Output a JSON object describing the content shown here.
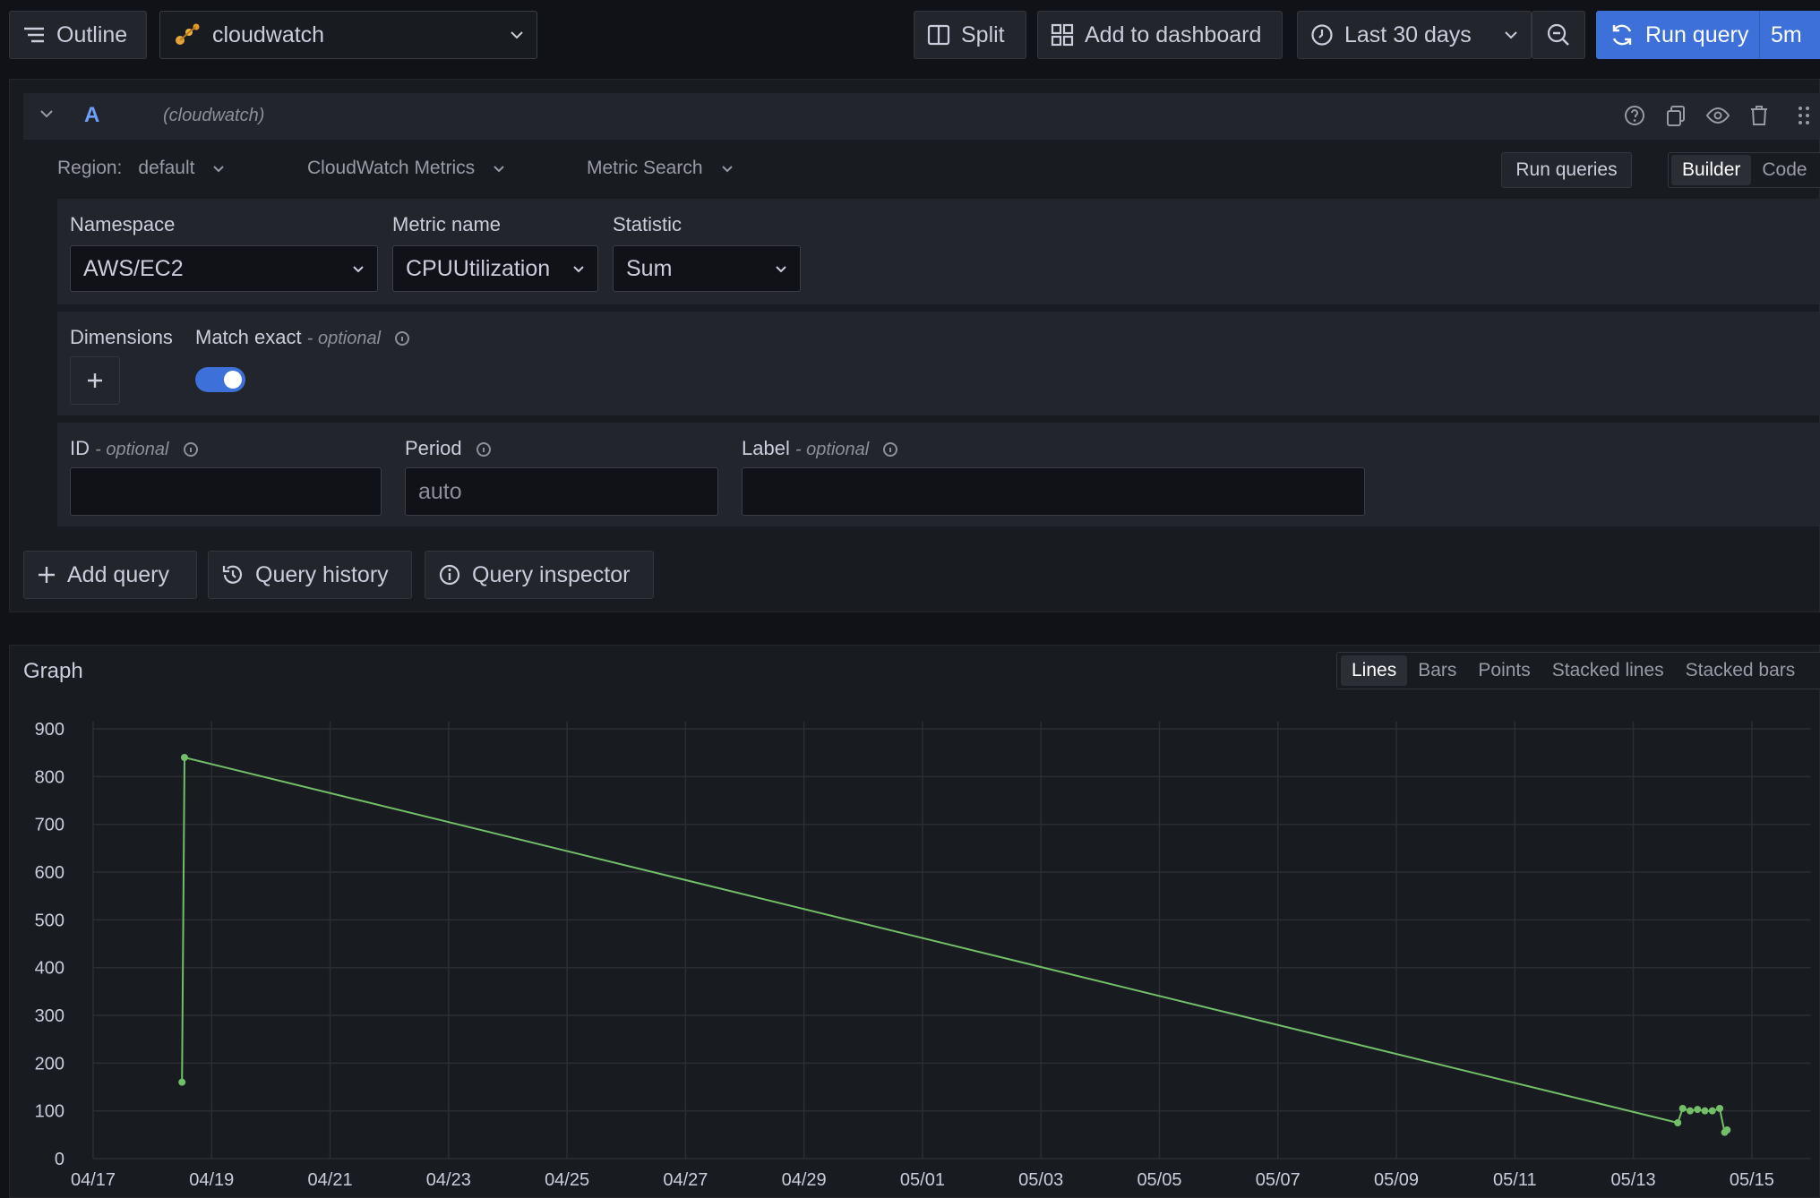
{
  "toolbar": {
    "outline_label": "Outline",
    "datasource": "cloudwatch",
    "split_label": "Split",
    "add_to_dashboard_label": "Add to dashboard",
    "time_range": "Last 30 days",
    "run_query_label": "Run query",
    "refresh_interval": "5m"
  },
  "query": {
    "ref_id": "A",
    "datasource_tag": "(cloudwatch)",
    "region_label": "Region:",
    "region_value": "default",
    "service": "CloudWatch Metrics",
    "mode": "Metric Search",
    "run_queries_label": "Run queries",
    "builder_label": "Builder",
    "code_label": "Code",
    "namespace_label": "Namespace",
    "namespace_value": "AWS/EC2",
    "metric_name_label": "Metric name",
    "metric_name_value": "CPUUtilization",
    "statistic_label": "Statistic",
    "statistic_value": "Sum",
    "dimensions_label": "Dimensions",
    "match_exact_label": "Match exact",
    "optional_text": "- optional",
    "id_label": "ID",
    "period_label": "Period",
    "period_placeholder": "auto",
    "label_label": "Label",
    "match_exact_enabled": true
  },
  "actions": {
    "add_query_label": "Add query",
    "query_history_label": "Query history",
    "query_inspector_label": "Query inspector"
  },
  "graph": {
    "title": "Graph",
    "modes": [
      "Lines",
      "Bars",
      "Points",
      "Stacked lines",
      "Stacked bars"
    ],
    "active_mode": "Lines"
  },
  "colors": {
    "accent": "#3d71d9",
    "series": "#73bf69"
  },
  "chart_data": {
    "type": "line",
    "title": "",
    "xlabel": "",
    "ylabel": "",
    "ylim": [
      0,
      900
    ],
    "yticks": [
      0,
      100,
      200,
      300,
      400,
      500,
      600,
      700,
      800,
      900
    ],
    "xlim": [
      "2024-04-17",
      "2024-05-16"
    ],
    "xticks": [
      "04/17",
      "04/19",
      "04/21",
      "04/23",
      "04/25",
      "04/27",
      "04/29",
      "05/01",
      "05/03",
      "05/05",
      "05/07",
      "05/09",
      "05/11",
      "05/13",
      "05/15"
    ],
    "grid": true,
    "series": [
      {
        "name": "",
        "points": [
          {
            "x": "2024-04-18 12:00",
            "y": 160
          },
          {
            "x": "2024-04-18 13:00",
            "y": 840
          },
          {
            "x": "2024-05-13 18:00",
            "y": 75
          },
          {
            "x": "2024-05-13 20:00",
            "y": 105
          },
          {
            "x": "2024-05-13 23:00",
            "y": 100
          },
          {
            "x": "2024-05-14 02:00",
            "y": 103
          },
          {
            "x": "2024-05-14 05:00",
            "y": 100
          },
          {
            "x": "2024-05-14 08:00",
            "y": 100
          },
          {
            "x": "2024-05-14 11:00",
            "y": 105
          },
          {
            "x": "2024-05-14 13:00",
            "y": 55
          },
          {
            "x": "2024-05-14 14:00",
            "y": 60
          }
        ]
      }
    ]
  }
}
